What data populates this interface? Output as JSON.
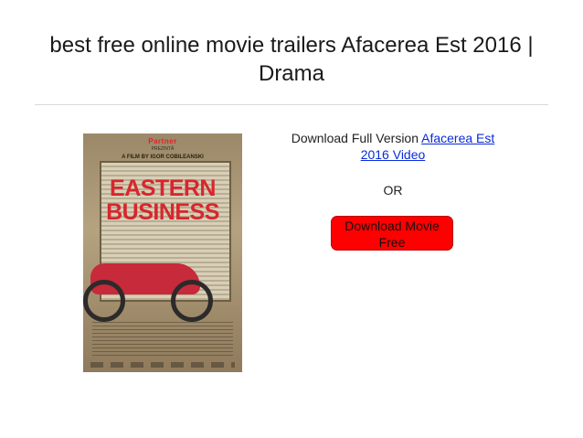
{
  "page": {
    "title": "best free online movie trailers Afacerea Est 2016 | Drama"
  },
  "poster": {
    "brand": "Partner",
    "presents": "PREZINTĂ",
    "film_by": "A FILM BY IGOR COBILEANSKI",
    "title_line1": "EASTERN",
    "title_line2": "BUSINESS"
  },
  "download": {
    "prefix": "Download Full Version ",
    "link_text": "Afacerea Est 2016 Video",
    "or_text": "OR",
    "button_label": "Download Movie Free"
  },
  "colors": {
    "button": "#ff0000",
    "link": "#0a2bd8",
    "poster_title": "#d7262c"
  }
}
